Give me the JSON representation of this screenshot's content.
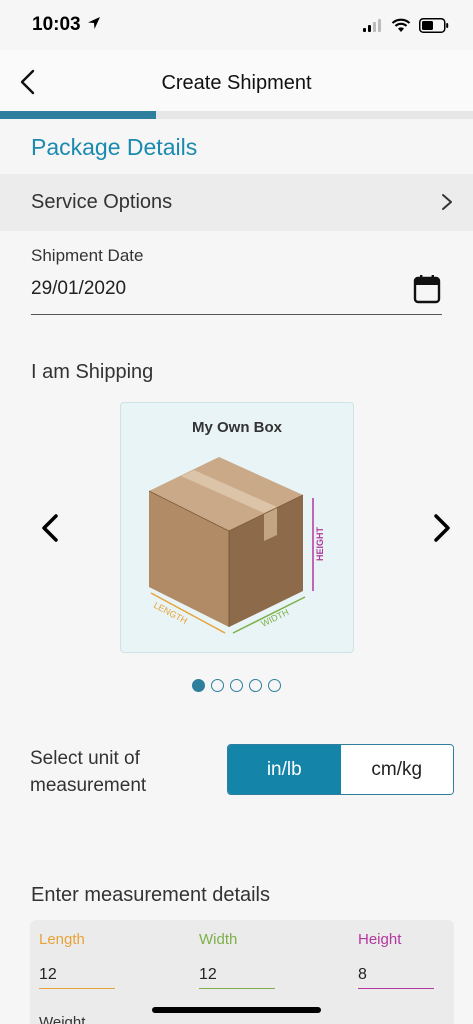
{
  "status": {
    "time": "10:03"
  },
  "nav": {
    "title": "Create Shipment",
    "back_icon": "chevron-left-icon"
  },
  "progress": {
    "fraction": 0.33
  },
  "section": {
    "title": "Package Details"
  },
  "service_options": {
    "label": "Service Options"
  },
  "shipment_date": {
    "label": "Shipment Date",
    "value": "29/01/2020"
  },
  "shipping": {
    "label": "I am Shipping"
  },
  "carousel": {
    "card_title": "My Own Box",
    "illustration_labels": {
      "length": "LENGTH",
      "width": "WIDTH",
      "height": "HEIGHT"
    },
    "page_count": 5,
    "active_index": 0
  },
  "unit": {
    "label": "Select unit of measurement",
    "options": [
      "in/lb",
      "cm/kg"
    ],
    "selected": "in/lb"
  },
  "measurements": {
    "label": "Enter measurement details",
    "fields": [
      {
        "label": "Length",
        "value": "12",
        "color": "#e8a33a"
      },
      {
        "label": "Width",
        "value": "12",
        "color": "#7db04a"
      },
      {
        "label": "Height",
        "value": "8",
        "color": "#b2379e"
      }
    ],
    "weight_label": "Weight"
  },
  "colors": {
    "accent": "#2d7f9d",
    "title": "#1b8ab0",
    "toggle_active": "#1584a9"
  }
}
